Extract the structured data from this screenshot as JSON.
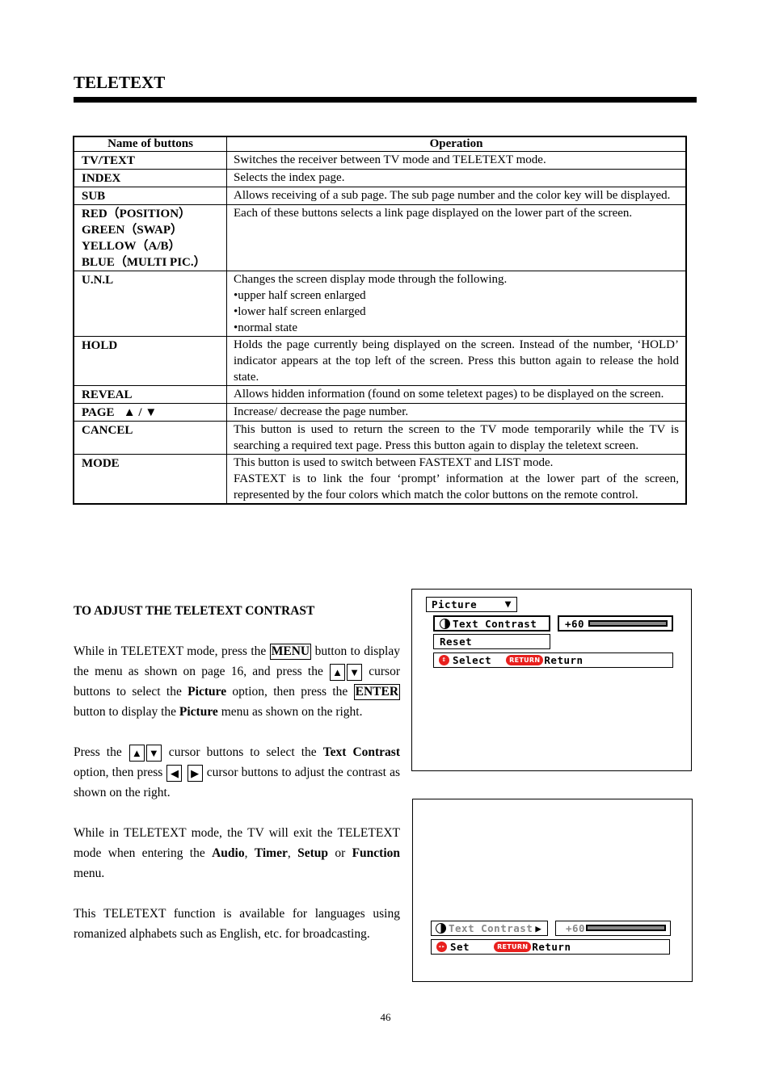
{
  "header": {
    "title": "TELETEXT"
  },
  "table": {
    "headers": [
      "Name of buttons",
      "Operation"
    ],
    "rows": [
      {
        "name_lines": [
          "TV/TEXT"
        ],
        "op_lines": [
          "Switches the receiver between TV mode and TELETEXT mode."
        ]
      },
      {
        "name_lines": [
          "INDEX"
        ],
        "op_lines": [
          "Selects the index page."
        ]
      },
      {
        "name_lines": [
          "SUB"
        ],
        "op_lines": [
          "Allows receiving of a sub page. The sub page number and the color key will be displayed."
        ]
      },
      {
        "name_lines": [
          "RED（POSITION）",
          "GREEN（SWAP）",
          "YELLOW（A/B）",
          "BLUE（MULTI PIC.）"
        ],
        "op_lines": [
          "Each of these buttons selects a link page displayed on the lower part of the screen."
        ]
      },
      {
        "name_lines": [
          "U.N.L"
        ],
        "op_lines": [
          "Changes the screen display mode through the following.",
          "•upper half screen enlarged",
          "•lower half screen enlarged",
          "•normal state"
        ]
      },
      {
        "name_lines": [
          "HOLD"
        ],
        "op_lines": [
          "Holds the page currently being displayed on the screen. Instead of the number, ‘HOLD’ indicator appears at the top left of the screen. Press this button again to release the hold state."
        ]
      },
      {
        "name_lines": [
          "REVEAL"
        ],
        "op_lines": [
          "Allows hidden information (found on some teletext pages) to be displayed on the screen."
        ]
      },
      {
        "name_lines": [
          "PAGE   ▲ / ▼"
        ],
        "op_lines": [
          "Increase/ decrease the page number."
        ]
      },
      {
        "name_lines": [
          "CANCEL"
        ],
        "op_lines": [
          "This button is used to return the screen to the TV mode temporarily while the TV is searching a required text page. Press this button again to display the teletext screen."
        ]
      },
      {
        "name_lines": [
          "MODE"
        ],
        "op_lines": [
          "This button is used to switch between FASTEXT and LIST mode.",
          "FASTEXT is to link the four ‘prompt’ information at the lower part of the screen, represented by the four colors which match the color buttons on the remote control."
        ]
      }
    ]
  },
  "section": {
    "heading": "TO ADJUST THE TELETEXT CONTRAST",
    "p1": {
      "t1": "While in TELETEXT mode, press the ",
      "key_menu": "MENU",
      "t2": " button to display the menu as shown on page 16, and press the ",
      "up": "▲",
      "down": "▼",
      "t3": " cursor buttons to select the ",
      "b_picture": "Picture",
      "t4": " option, then press the ",
      "key_enter": "ENTER",
      "t5": " button to display the ",
      "b_picture2": "Picture",
      "t6": " menu as shown on the right."
    },
    "p2": {
      "t1": "Press the ",
      "up": "▲",
      "down": "▼",
      "t2": " cursor buttons to select the ",
      "b_text_contrast": "Text Contrast",
      "t3": " option, then press ",
      "left": "◀",
      "right": "▶",
      "t4": " cursor buttons to adjust the contrast as shown on the right."
    },
    "p3": {
      "t1": "While in TELETEXT mode, the TV will exit the TELETEXT mode when entering the ",
      "b_audio": "Audio",
      "c1": ", ",
      "b_timer": "Timer",
      "c2": ", ",
      "b_setup": "Setup",
      "t2": " or ",
      "b_function": "Function",
      "t3": " menu."
    },
    "p4": "This TELETEXT function is available for languages using romanized alphabets such as English, etc. for broadcasting."
  },
  "osd1": {
    "menu_title": "Picture",
    "dropdown_icon": "▼",
    "item_text_contrast": "Text Contrast",
    "value": "+60",
    "bar_fill_percent": 100,
    "item_reset": "Reset",
    "hint_select": "Select",
    "return_badge": "RETURN",
    "hint_return": "Return",
    "select_icon": "⇕"
  },
  "osd2": {
    "item_text_contrast": "Text Contrast",
    "arrow": "▶",
    "value": "+60",
    "bar_fill_percent": 100,
    "hint_set": "Set",
    "return_badge": "RETURN",
    "hint_return": "Return",
    "set_icon": "◂▸"
  },
  "colors": {
    "osd_red": "#e8201e",
    "bar_gray": "#888888"
  },
  "footer": {
    "page_number": "46"
  }
}
